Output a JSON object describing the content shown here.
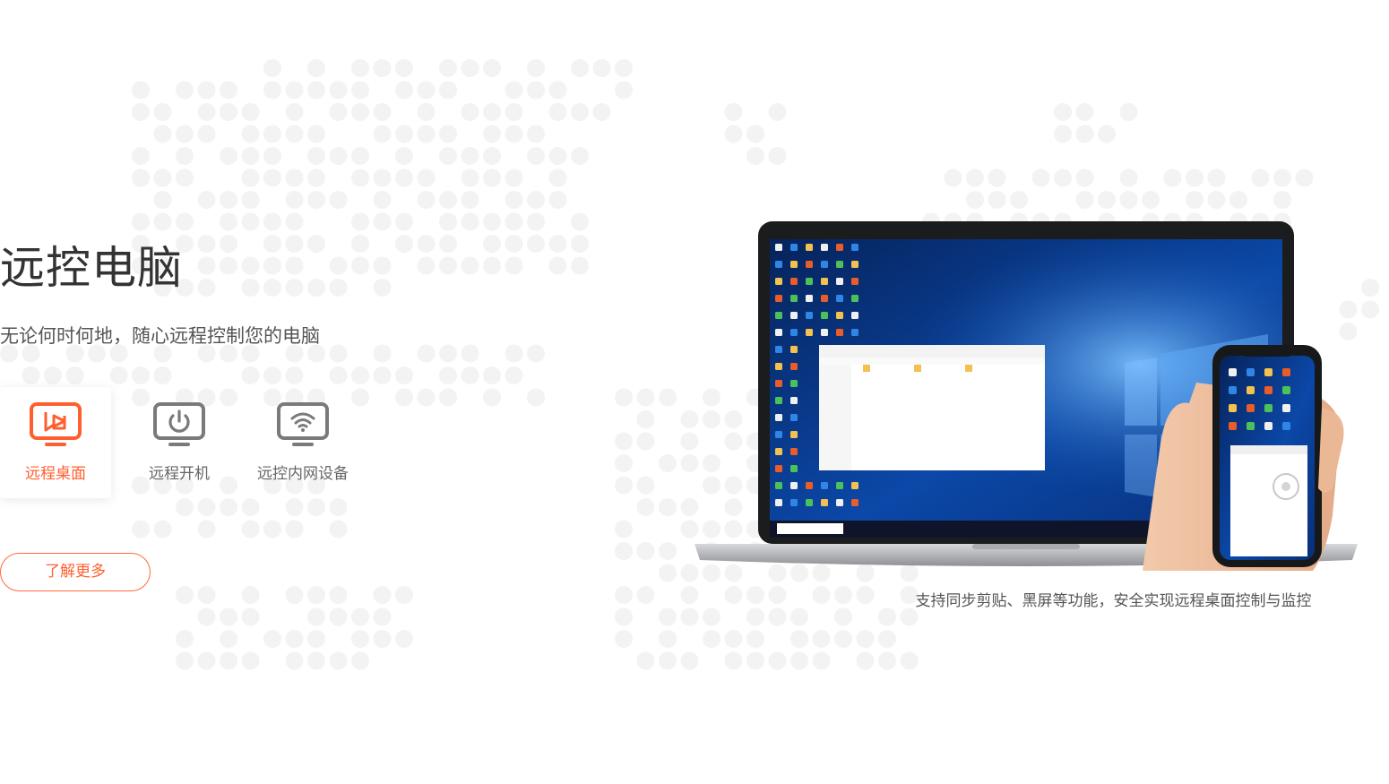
{
  "hero": {
    "title": "远控电脑",
    "subtitle": "无论何时何地，随心远程控制您的电脑",
    "features": [
      {
        "label": "远程桌面",
        "icon": "remote-desktop-icon",
        "active": true
      },
      {
        "label": "远程开机",
        "icon": "power-on-icon",
        "active": false
      },
      {
        "label": "远控内网设备",
        "icon": "lan-device-icon",
        "active": false
      }
    ],
    "more_label": "了解更多"
  },
  "showcase": {
    "caption": "支持同步剪贴、黑屏等功能，安全实现远程桌面控制与监控",
    "laptop_image": "laptop-windows-desktop",
    "phone_image": "phone-remote-control"
  },
  "colors": {
    "accent": "#ff5f2e",
    "text_primary": "#333333",
    "text_secondary": "#666666",
    "bg_dots": "#f2f2f2",
    "desktop_bg": "#0b3a86"
  }
}
